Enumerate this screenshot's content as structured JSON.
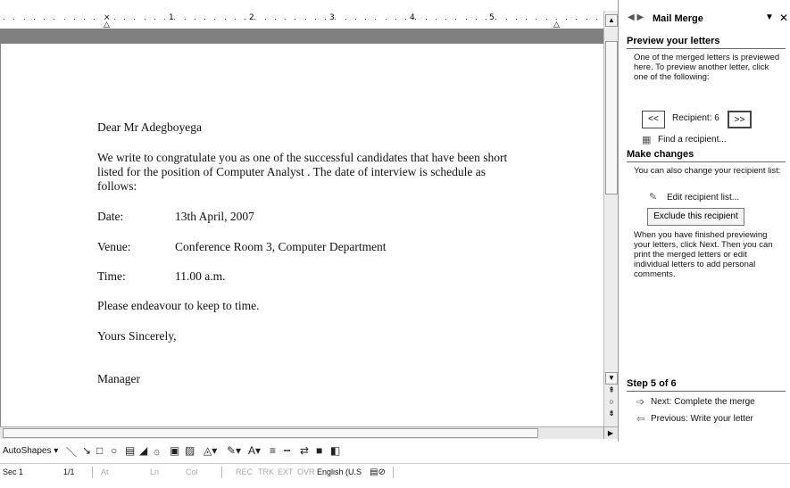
{
  "ruler": {
    "numbers": [
      "1",
      "2",
      "3",
      "4",
      "5"
    ]
  },
  "letter": {
    "salutation": "Dear Mr Adegboyega",
    "body_line1": "We write to congratulate you as one of the successful candidates that have been short",
    "body_line2": "listed for the position of  Computer Analyst . The date of interview is schedule as",
    "body_line3": "follows:",
    "date_label": "Date:",
    "date_value": "13th April, 2007",
    "venue_label": "Venue:",
    "venue_value": "Conference Room 3, Computer Department",
    "time_label": "Time:",
    "time_value": "11.00 a.m.",
    "endeavour": "Please endeavour to keep to time.",
    "closing": "Yours Sincerely,",
    "signature": "Manager"
  },
  "pane": {
    "title": "Mail Merge",
    "preview_heading": "Preview your letters",
    "preview_text": "One of the merged letters is previewed here. To preview another letter, click one of the following:",
    "prev_btn": "<<",
    "recipient_label": "Recipient: 6",
    "next_btn": ">>",
    "find_recipient": "Find a recipient...",
    "make_changes_heading": "Make changes",
    "change_text": "You can also change your recipient list:",
    "edit_list": "Edit recipient list...",
    "exclude_btn": "Exclude this recipient",
    "finish_text": "When you have finished previewing your letters, click Next. Then you can print the merged letters or edit individual letters to add personal comments.",
    "step": "Step 5 of 6",
    "next_step": "Next: Complete the merge",
    "prev_step": "Previous: Write your letter"
  },
  "drawbar": {
    "autoshapes": "AutoShapes"
  },
  "status": {
    "sec": "Sec 1",
    "page": "1/1",
    "at": "At",
    "ln": "Ln",
    "col": "Col",
    "rec": "REC",
    "trk": "TRK",
    "ext": "EXT",
    "ovr": "OVR",
    "lang": "English (U.S"
  },
  "colors": {
    "band": "#808080",
    "pane_bg": "#ffffff"
  }
}
